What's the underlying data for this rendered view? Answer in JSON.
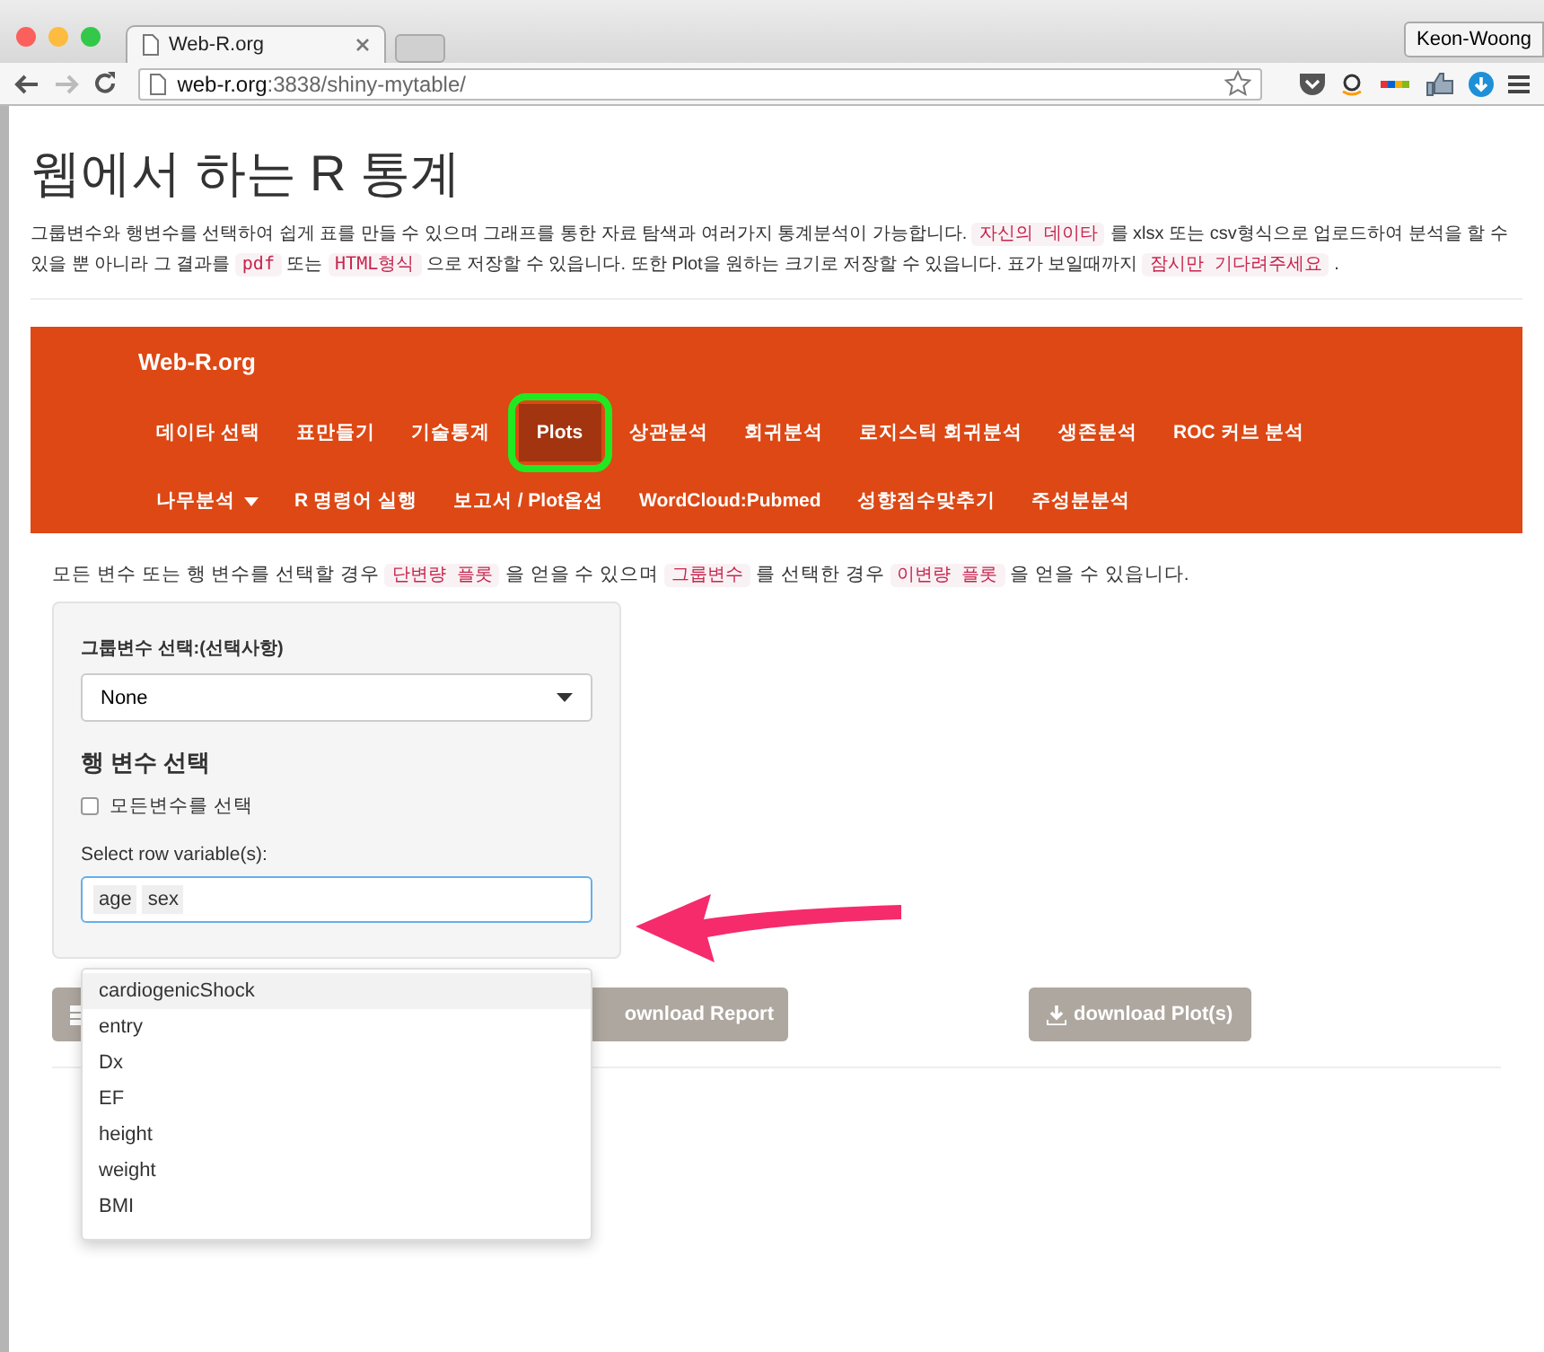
{
  "browser": {
    "tab_title": "Web-R.org",
    "url_host": "web-r.org",
    "url_path": ":3838/shiny-mytable/",
    "profile": "Keon-Woong"
  },
  "page": {
    "title": "웹에서 하는 R 통계",
    "intro": [
      {
        "kind": "plain",
        "text": "그룹변수와 행변수를 선택하여 쉽게 표를 만들 수 있으며 그래프를 통한 자료 탐색과 여러가지 통계분석이 가능합니다. "
      },
      {
        "kind": "code",
        "text": "자신의 데이타"
      },
      {
        "kind": "plain",
        "text": " 를 xlsx 또는 csv형식으로 업로드하여 분석을 할 수 있을 뿐 아니라 그 결과를 "
      },
      {
        "kind": "code",
        "text": "pdf"
      },
      {
        "kind": "plain",
        "text": " 또는 "
      },
      {
        "kind": "code",
        "text": "HTML형식"
      },
      {
        "kind": "plain",
        "text": " 으로 저장할 수 있읍니다. 또한 Plot을 원하는 크기로 저장할 수 있읍니다. 표가 보일때까지 "
      },
      {
        "kind": "code",
        "text": "잠시만 기다려주세요"
      },
      {
        "kind": "plain",
        "text": " ."
      }
    ]
  },
  "navbar": {
    "brand": "Web-R.org",
    "items": [
      {
        "label": "데이타 선택",
        "selected": false
      },
      {
        "label": "표만들기",
        "selected": false
      },
      {
        "label": "기술통계",
        "selected": false
      },
      {
        "label": "Plots",
        "selected": true
      },
      {
        "label": "상관분석",
        "selected": false
      },
      {
        "label": "회귀분석",
        "selected": false
      },
      {
        "label": "로지스틱 회귀분석",
        "selected": false
      },
      {
        "label": "생존분석",
        "selected": false
      },
      {
        "label": "ROC 커브 분석",
        "selected": false
      },
      {
        "label": "나무분석",
        "selected": false,
        "dropdown": true
      },
      {
        "label": "R 명령어 실행",
        "selected": false
      },
      {
        "label": "보고서 / Plot옵션",
        "selected": false
      },
      {
        "label": "WordCloud:Pubmed",
        "selected": false
      },
      {
        "label": "성향점수맞추기",
        "selected": false
      },
      {
        "label": "주성분분석",
        "selected": false
      }
    ]
  },
  "note": [
    {
      "kind": "plain",
      "text": "모든 변수 또는 행 변수를 선택할 경우 "
    },
    {
      "kind": "code",
      "text": "단변량 플롯"
    },
    {
      "kind": "plain",
      "text": " 을 얻을 수 있으며 "
    },
    {
      "kind": "code",
      "text": "그룹변수"
    },
    {
      "kind": "plain",
      "text": " 를 선택한 경우 "
    },
    {
      "kind": "code",
      "text": "이변량 플롯"
    },
    {
      "kind": "plain",
      "text": " 을 얻을 수 있읍니다."
    }
  ],
  "panel": {
    "group_label": "그룹변수 선택:(선택사항)",
    "group_value": "None",
    "row_heading": "행 변수 선택",
    "all_checkbox": {
      "label": "모든변수를 선택",
      "checked": false
    },
    "row_label": "Select row variable(s):",
    "tags": [
      "age",
      "sex"
    ],
    "options": [
      {
        "label": "cardiogenicShock",
        "selected": true
      },
      {
        "label": "entry",
        "selected": false
      },
      {
        "label": "Dx",
        "selected": false
      },
      {
        "label": "EF",
        "selected": false
      },
      {
        "label": "height",
        "selected": false
      },
      {
        "label": "weight",
        "selected": false
      },
      {
        "label": "BMI",
        "selected": false
      }
    ]
  },
  "buttons": [
    {
      "kind": "table"
    },
    {
      "kind": "plain",
      "label": "ownload Report"
    },
    {
      "kind": "download",
      "label": "download Plot(s)"
    }
  ]
}
